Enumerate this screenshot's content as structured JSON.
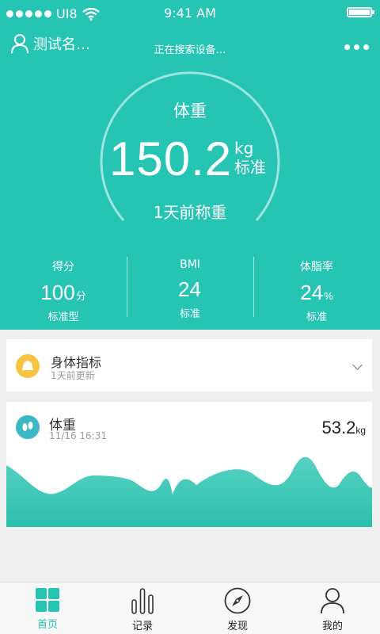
{
  "status_bar": {
    "carrier": "UI8",
    "time": "9:41 AM"
  },
  "header": {
    "user_name": "测试名…",
    "status": "正在搜索设备…"
  },
  "weight": {
    "label": "体重",
    "value": "150.2",
    "unit": "kg",
    "status": "标准",
    "measured": "1天前称重"
  },
  "stats": [
    {
      "label": "得分",
      "value": "100",
      "unit": "分",
      "status": "标准型"
    },
    {
      "label": "BMI",
      "value": "24",
      "unit": "",
      "status": "标准"
    },
    {
      "label": "体脂率",
      "value": "24",
      "unit": "%",
      "status": "标准"
    }
  ],
  "body_card": {
    "title": "身体指标",
    "subtitle": "1天前更新"
  },
  "weight_card": {
    "title": "体重",
    "date": "11/16  16:31",
    "value": "53.2",
    "unit": "kg"
  },
  "tabs": [
    {
      "label": "首页",
      "icon": "home-grid-icon",
      "active": true
    },
    {
      "label": "记录",
      "icon": "bar-chart-icon",
      "active": false
    },
    {
      "label": "发现",
      "icon": "compass-icon",
      "active": false
    },
    {
      "label": "我的",
      "icon": "profile-icon",
      "active": false
    }
  ],
  "colors": {
    "primary": "#26c4b2",
    "card_icon_yellow": "#f7c341",
    "card_icon_blue": "#3cb7c6",
    "background": "#efefef"
  }
}
